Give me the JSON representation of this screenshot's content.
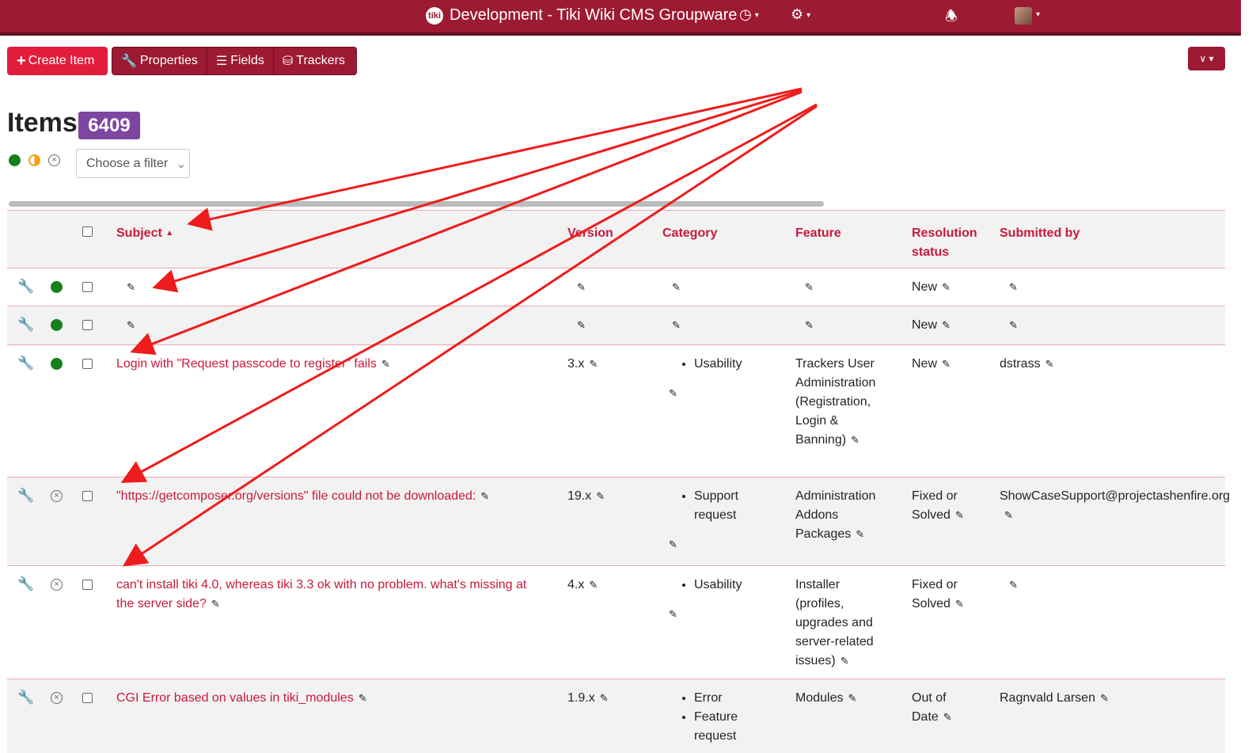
{
  "topbar": {
    "logo_text": "tiki",
    "title": "Development - Tiki Wiki CMS Groupware",
    "icons": [
      "clock-icon",
      "gears-icon",
      "bell-icon",
      "avatar"
    ]
  },
  "toolbar": {
    "create_label": "Create Item",
    "properties_label": "Properties",
    "fields_label": "Fields",
    "trackers_label": "Trackers"
  },
  "page": {
    "title": "Items",
    "count": "6409",
    "filter_placeholder": "Choose a filter"
  },
  "table": {
    "headers": [
      "Subject",
      "Version",
      "Category",
      "Feature",
      "Resolution status",
      "Submitted by"
    ],
    "rows": [
      {
        "status": "green",
        "subject": "",
        "version": "",
        "category": [],
        "feature": "",
        "resolution": "New",
        "submitted_by": ""
      },
      {
        "status": "green",
        "subject": "",
        "version": "",
        "category": [],
        "feature": "",
        "resolution": "New",
        "submitted_by": ""
      },
      {
        "status": "green",
        "subject": "Login with \"Request passcode to register\" fails",
        "version": "3.x",
        "category": [
          "Usability"
        ],
        "feature": "Trackers User Administration (Registration, Login & Banning)",
        "resolution": "New",
        "submitted_by": "dstrass"
      },
      {
        "status": "closed",
        "subject": "\"https://getcomposer.org/versions\" file could not be downloaded:",
        "version": "19.x",
        "category": [
          "Support request"
        ],
        "feature": "Administration Addons Packages",
        "resolution": "Fixed or Solved",
        "submitted_by": "ShowCaseSupport@projectashenfire.org"
      },
      {
        "status": "closed",
        "subject": "can't install tiki 4.0, whereas tiki 3.3 ok with no problem. what's missing at the server side?",
        "version": "4.x",
        "category": [
          "Usability"
        ],
        "feature": "Installer (profiles, upgrades and server-related issues)",
        "resolution": "Fixed or Solved",
        "submitted_by": ""
      },
      {
        "status": "closed",
        "subject": "CGI Error based on values in tiki_modules",
        "version": "1.9.x",
        "category": [
          "Error",
          "Feature request"
        ],
        "feature": "Modules",
        "resolution": "Out of Date",
        "submitted_by": "Ragnvald Larsen"
      }
    ]
  },
  "colors": {
    "brand": "#9c1a32",
    "accent": "#c8193b",
    "badge": "#7d46a0",
    "arrow": "#ee1c1c"
  }
}
